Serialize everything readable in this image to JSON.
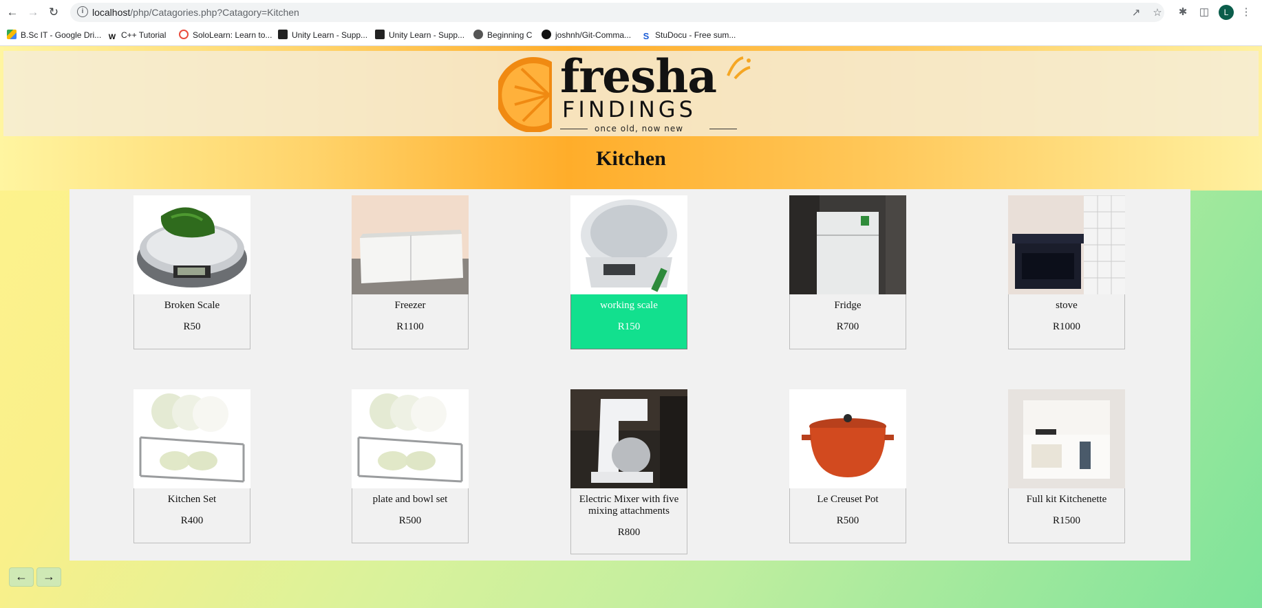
{
  "browser": {
    "url_host": "localhost",
    "url_path": "/php/Catagories.php?Catagory=Kitchen",
    "avatar_letter": "L",
    "bookmarks": [
      {
        "label": "B.Sc IT - Google Dri...",
        "icon": "google-drive-icon",
        "color": "#1a73e8"
      },
      {
        "label": "C++ Tutorial",
        "icon": "w3schools-icon",
        "color": "#222222"
      },
      {
        "label": "SoloLearn: Learn to...",
        "icon": "sololearn-icon",
        "color": "#e94b3c"
      },
      {
        "label": "Unity Learn - Supp...",
        "icon": "unity-icon",
        "color": "#222222"
      },
      {
        "label": "Unity Learn - Supp...",
        "icon": "unity-icon",
        "color": "#222222"
      },
      {
        "label": "Beginning C",
        "icon": "globe-icon",
        "color": "#444444"
      },
      {
        "label": "joshnh/Git-Comma...",
        "icon": "github-icon",
        "color": "#111111"
      },
      {
        "label": "StuDocu - Free sum...",
        "icon": "studocu-icon",
        "color": "#1b5cd6"
      }
    ]
  },
  "logo": {
    "word1": "fresha",
    "word2": "FINDINGS",
    "tagline": "once old, now new"
  },
  "page": {
    "title": "Kitchen"
  },
  "products": [
    {
      "name": "Broken Scale",
      "price": "R50",
      "image": "kitchen-scale-image",
      "highlighted": false
    },
    {
      "name": "Freezer",
      "price": "R1100",
      "image": "chest-freezer-image",
      "highlighted": false
    },
    {
      "name": "working scale",
      "price": "R150",
      "image": "digital-scale-image",
      "highlighted": true
    },
    {
      "name": "Fridge",
      "price": "R700",
      "image": "fridge-image",
      "highlighted": false
    },
    {
      "name": "stove",
      "price": "R1000",
      "image": "stove-image",
      "highlighted": false
    },
    {
      "name": "Kitchen Set",
      "price": "R400",
      "image": "dish-rack-image",
      "highlighted": false
    },
    {
      "name": "plate and bowl set",
      "price": "R500",
      "image": "dish-rack-image",
      "highlighted": false
    },
    {
      "name": "Electric Mixer with five mixing attachments",
      "price": "R800",
      "image": "stand-mixer-image",
      "highlighted": false
    },
    {
      "name": "Le Creuset Pot",
      "price": "R500",
      "image": "red-pot-image",
      "highlighted": false
    },
    {
      "name": "Full kit Kitchenette",
      "price": "R1500",
      "image": "toy-kitchen-image",
      "highlighted": false
    }
  ],
  "pager": {
    "prev": "←",
    "next": "→"
  },
  "colors": {
    "highlight": "#12e08e",
    "panel": "#f1f1f1",
    "orange": "#ffad2a"
  }
}
